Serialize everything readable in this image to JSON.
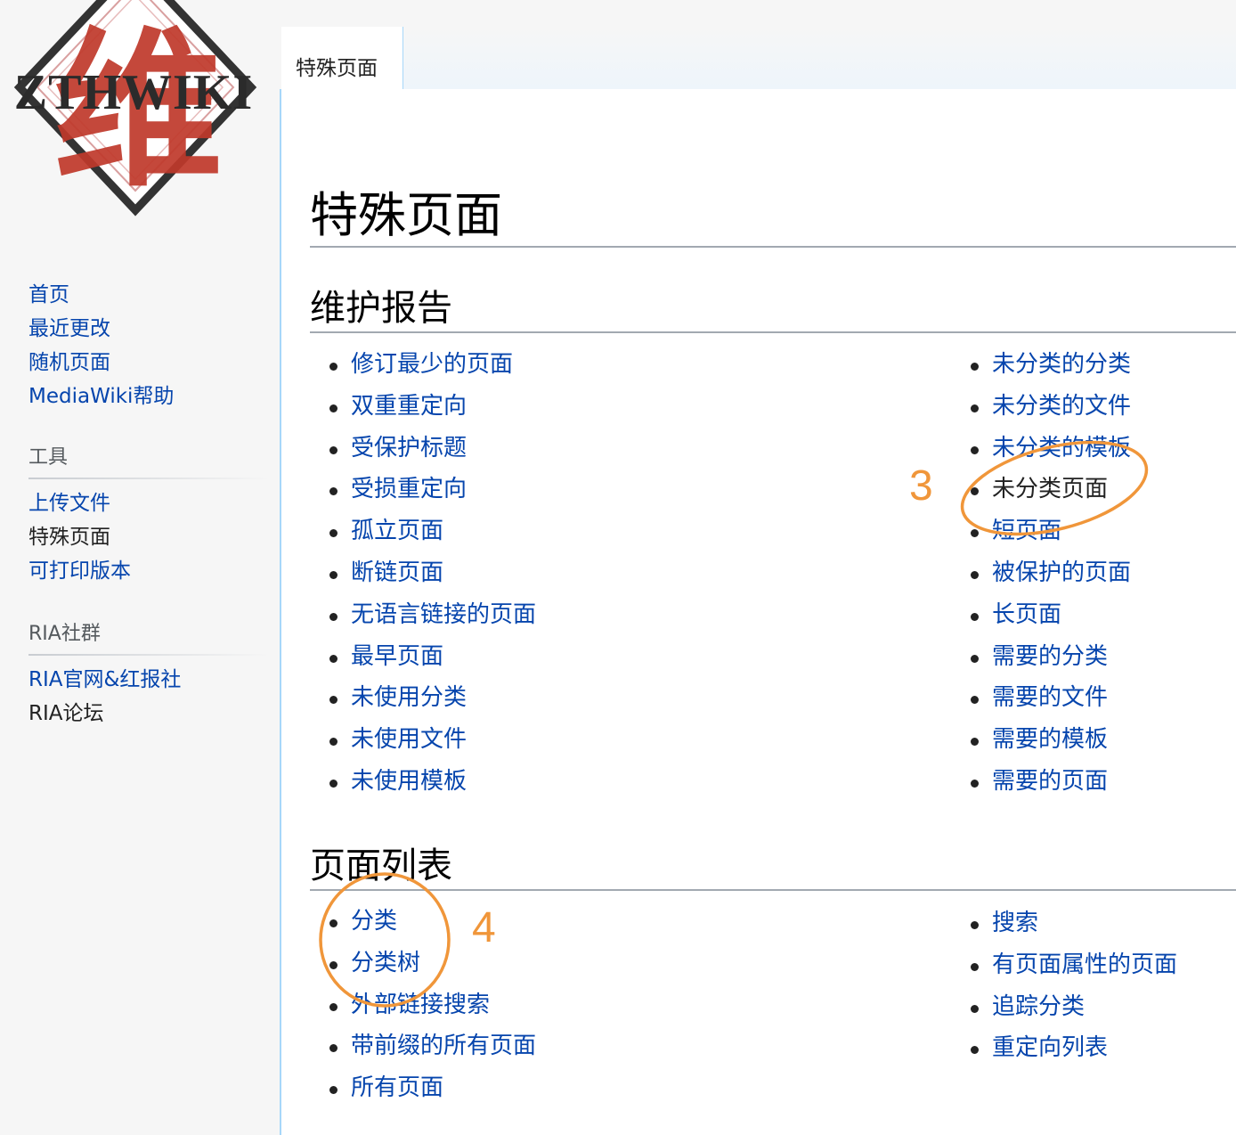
{
  "logo": {
    "text": "ZTHWIKI",
    "glyph": "维",
    "colors": {
      "red": "#c0392b",
      "dark": "#3a3a3a"
    }
  },
  "tab": {
    "label": "特殊页面"
  },
  "sidebar": {
    "main": [
      "首页",
      "最近更改",
      "随机页面",
      "MediaWiki帮助"
    ],
    "tools": {
      "heading": "工具",
      "items": [
        "上传文件",
        "特殊页面",
        "可打印版本"
      ]
    },
    "community": {
      "heading": "RIA社群",
      "items": [
        "RIA官网&红报社",
        "RIA论坛"
      ]
    }
  },
  "page": {
    "title": "特殊页面"
  },
  "maintenance": {
    "heading": "维护报告",
    "left": [
      "修订最少的页面",
      "双重重定向",
      "受保护标题",
      "受损重定向",
      "孤立页面",
      "断链页面",
      "无语言链接的页面",
      "最早页面",
      "未使用分类",
      "未使用文件",
      "未使用模板"
    ],
    "right": [
      "未分类的分类",
      "未分类的文件",
      "未分类的模板",
      "未分类页面",
      "短页面",
      "被保护的页面",
      "长页面",
      "需要的分类",
      "需要的文件",
      "需要的模板",
      "需要的页面"
    ]
  },
  "lists": {
    "heading": "页面列表",
    "left": [
      "分类",
      "分类树",
      "外部链接搜索",
      "带前缀的所有页面",
      "所有页面"
    ],
    "right": [
      "搜索",
      "有页面属性的页面",
      "追踪分类",
      "重定向列表"
    ]
  },
  "annotations": {
    "marker_3": "3",
    "marker_4": "4",
    "color": "#f0963a"
  },
  "colors": {
    "link": "#0645ad",
    "text": "#222222",
    "border": "#a7d7f9"
  }
}
